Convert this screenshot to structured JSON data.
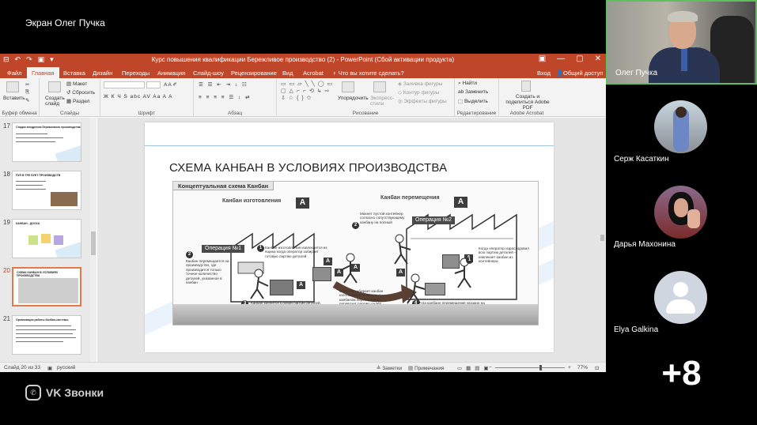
{
  "screen_title": "Экран Олег Пучка",
  "ppt": {
    "qat": [
      "⊟",
      "↶",
      "↷",
      "▣",
      "▾"
    ],
    "title": "Курс повышения квалификации Бережливое производство (2) - PowerPoint (Сбой активации продукта)",
    "window_controls": [
      "▣",
      "—",
      "▢",
      "✕"
    ],
    "tabs": [
      "Файл",
      "Главная",
      "Вставка",
      "Дизайн",
      "Переходы",
      "Анимация",
      "Слайд-шоу",
      "Рецензирование",
      "Вид",
      "Acrobat"
    ],
    "tell_me": "♀ Что вы хотите сделать?",
    "signin": "Вход",
    "share": "Общий доступ",
    "ribbon": {
      "paste": "Вставить",
      "new_slide": "Создать слайд",
      "layout": "Макет",
      "reset": "Сбросить",
      "section": "Раздел",
      "arrange": "Упорядочить",
      "quick_styles": "Экспресс-стили",
      "shape_fill": "Заливка фигуры",
      "shape_outline": "Контур фигуры",
      "shape_effects": "Эффекты фигуры",
      "find": "Найти",
      "replace": "Заменить",
      "select": "Выделить",
      "create_share": "Создать и поделиться Adobe PDF",
      "groups": [
        "Буфер обмена",
        "Слайды",
        "Шрифт",
        "Абзац",
        "Рисование",
        "Редактирование",
        "Adobe Acrobat"
      ],
      "font_buttons": "Ж К Ч S abc AV Aa A A",
      "para_buttons": "≡ ≡ ≡ ≡ ☰ ↕ ⇄",
      "shape_glyphs": "▭ ▭ ▱ ╲ ╲ ◯ ▭ ▢ △ ⌐ ⌐ ⟲ ↳ ⇨ ⇩ ☆ { } ✩"
    },
    "thumbs": [
      {
        "num": "17",
        "title": "Стадии внедрения бережливого производства"
      },
      {
        "num": "18",
        "title": "ПУЛ В ТРЕ БУЕТ ПРОИЗВОДСТВ"
      },
      {
        "num": "19",
        "title": "КАНБАН - ДОСКА"
      },
      {
        "num": "20",
        "title": "СХЕМА КАНБАН В УСЛОВИЯХ ПРОИЗВОДСТВА"
      },
      {
        "num": "21",
        "title": "Организация работы Канбан-системы"
      }
    ],
    "slide": {
      "title": "СХЕМА КАНБАН В УСЛОВИЯХ ПРОИЗВОДСТВА",
      "diagram_header": "Концептуальная схема Канбан",
      "kanban_make": "Канбан изготовления",
      "kanban_move": "Канбан перемещения",
      "card_letter": "A",
      "op1": "Операция №1",
      "op2": "Операция №2",
      "notes": {
        "n1_num": "1",
        "n1": "Канбан изготовления извлекается из ящика когда оператор забирает готовую партию деталей",
        "n2_num": "2",
        "n2": "Канбан перемещается на производство, где производится только точное количество деталей, указанное в канбан",
        "n2r_num": "2",
        "n2r": "Махнет пустой контейнер согласно сопутствующему канбану на полный",
        "n1r_num": "1",
        "n1r": "Когда оператор израсходовал всю партию деталей – извлекает канбан из контейнера",
        "n3_num": "3",
        "n3": "Канбан крепится к новой партии деталей, готовой к следующей операции",
        "n3m": "Оператор убирает канбан изготовления и вместе с канбаном перемещения перевозит партию далее",
        "n4_num": "4",
        "n4": "На канбане перемещения указано на какую операцию нужно доставить эту партию деталей"
      }
    },
    "status": {
      "slide_counter": "Слайд 20 из 33",
      "language": "русский",
      "notes": "≜ Заметки",
      "comments": "▤ Примечания",
      "zoom": "77%"
    }
  },
  "brand": "VK Звонки",
  "brand_glyph": "✆",
  "participants": [
    {
      "name": "Олег Пучка",
      "active": true
    },
    {
      "name": "Серж Касаткин"
    },
    {
      "name": "Дарья Махонина"
    },
    {
      "name": "Elya Galkina"
    }
  ],
  "more_count": "+8",
  "colors": {
    "accent": "#c0462a",
    "speaking": "#5cc15c"
  }
}
